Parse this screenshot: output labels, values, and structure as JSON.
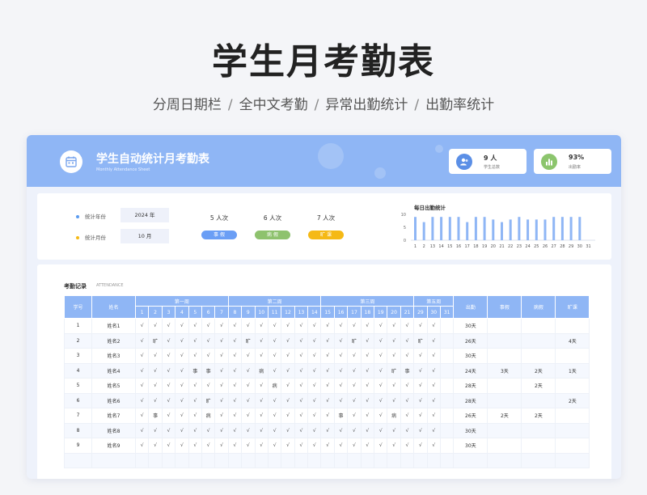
{
  "hero": {
    "title": "学生月考勤表",
    "features": [
      "分周日期栏",
      "全中文考勤",
      "异常出勤统计",
      "出勤率统计"
    ],
    "separator": "/"
  },
  "header": {
    "title": "学生自动统计月考勤表",
    "subtitle_en": "Monthly Attendance Sheet",
    "stats": [
      {
        "value": "9 人",
        "label": "学生总数",
        "icon": "users-icon",
        "color": "#5b8fe6"
      },
      {
        "value": "93%",
        "label": "出勤率",
        "icon": "bar-chart-icon",
        "color": "#8cc56d"
      }
    ]
  },
  "filters": {
    "year_label": "统计年份",
    "year_value": "2024 年",
    "month_label": "统计月份",
    "month_value": "10 月",
    "year_dot_color": "#5b9bf0",
    "month_dot_color": "#f5b915"
  },
  "summary": [
    {
      "count": "5 人次",
      "label": "事 假",
      "color": "#6a9ef5"
    },
    {
      "count": "6 人次",
      "label": "病 假",
      "color": "#8ec26e"
    },
    {
      "count": "7 人次",
      "label": "旷 课",
      "color": "#f5b915"
    }
  ],
  "chart_data": {
    "type": "bar",
    "title": "每日出勤统计",
    "categories": [
      "1",
      "2",
      "13",
      "14",
      "15",
      "16",
      "17",
      "18",
      "19",
      "20",
      "21",
      "22",
      "23",
      "24",
      "25",
      "26",
      "27",
      "28",
      "29",
      "30",
      "31"
    ],
    "values": [
      9,
      7,
      9,
      9,
      9,
      9,
      7,
      9,
      9,
      8,
      7,
      8,
      9,
      8,
      8,
      8,
      9,
      9,
      9,
      9,
      0
    ],
    "ylim": [
      0,
      10
    ],
    "yticks": [
      0,
      5,
      10
    ],
    "bar_color": "#8fb6f5"
  },
  "attendance": {
    "section_title": "考勤记录",
    "section_en": "ATTENDANCE",
    "headers": {
      "id": "学号",
      "name": "姓名",
      "weeks": [
        {
          "label": "第一周",
          "span": 7
        },
        {
          "label": "第二周",
          "span": 7
        },
        {
          "label": "第三周",
          "span": 7
        },
        {
          "label": "第五周",
          "span": 3
        }
      ],
      "days": [
        "1",
        "2",
        "3",
        "4",
        "5",
        "6",
        "7",
        "8",
        "9",
        "10",
        "11",
        "12",
        "13",
        "14",
        "15",
        "16",
        "17",
        "18",
        "19",
        "20",
        "21",
        "29",
        "30",
        "31"
      ],
      "summary": [
        "出勤",
        "事假",
        "病假",
        "旷课"
      ]
    },
    "rows": [
      {
        "id": "1",
        "name": "姓名1",
        "marks": [
          "√",
          "√",
          "√",
          "√",
          "√",
          "√",
          "√",
          "√",
          "√",
          "√",
          "√",
          "√",
          "√",
          "√",
          "√",
          "√",
          "√",
          "√",
          "√",
          "√",
          "√",
          "√",
          "√",
          ""
        ],
        "present": "30天",
        "leave": "",
        "sick": "",
        "absent": ""
      },
      {
        "id": "2",
        "name": "姓名2",
        "marks": [
          "√",
          "旷",
          "√",
          "√",
          "√",
          "√",
          "√",
          "√",
          "旷",
          "√",
          "√",
          "√",
          "√",
          "√",
          "√",
          "√",
          "旷",
          "√",
          "√",
          "√",
          "√",
          "旷",
          "√",
          ""
        ],
        "present": "26天",
        "leave": "",
        "sick": "",
        "absent": "4天"
      },
      {
        "id": "3",
        "name": "姓名3",
        "marks": [
          "√",
          "√",
          "√",
          "√",
          "√",
          "√",
          "√",
          "√",
          "√",
          "√",
          "√",
          "√",
          "√",
          "√",
          "√",
          "√",
          "√",
          "√",
          "√",
          "√",
          "√",
          "√",
          "√",
          ""
        ],
        "present": "30天",
        "leave": "",
        "sick": "",
        "absent": ""
      },
      {
        "id": "4",
        "name": "姓名4",
        "marks": [
          "√",
          "√",
          "√",
          "√",
          "事",
          "事",
          "√",
          "√",
          "√",
          "病",
          "√",
          "√",
          "√",
          "√",
          "√",
          "√",
          "√",
          "√",
          "√",
          "旷",
          "事",
          "√",
          "√",
          ""
        ],
        "present": "24天",
        "leave": "3天",
        "sick": "2天",
        "absent": "1天"
      },
      {
        "id": "5",
        "name": "姓名5",
        "marks": [
          "√",
          "√",
          "√",
          "√",
          "√",
          "√",
          "√",
          "√",
          "√",
          "√",
          "病",
          "√",
          "√",
          "√",
          "√",
          "√",
          "√",
          "√",
          "√",
          "√",
          "√",
          "√",
          "√",
          ""
        ],
        "present": "28天",
        "leave": "",
        "sick": "2天",
        "absent": ""
      },
      {
        "id": "6",
        "name": "姓名6",
        "marks": [
          "√",
          "√",
          "√",
          "√",
          "√",
          "旷",
          "√",
          "√",
          "√",
          "√",
          "√",
          "√",
          "√",
          "√",
          "√",
          "√",
          "√",
          "√",
          "√",
          "√",
          "√",
          "√",
          "√",
          ""
        ],
        "present": "28天",
        "leave": "",
        "sick": "",
        "absent": "2天"
      },
      {
        "id": "7",
        "name": "姓名7",
        "marks": [
          "√",
          "事",
          "√",
          "√",
          "√",
          "病",
          "√",
          "√",
          "√",
          "√",
          "√",
          "√",
          "√",
          "√",
          "√",
          "事",
          "√",
          "√",
          "√",
          "病",
          "√",
          "√",
          "√",
          ""
        ],
        "present": "26天",
        "leave": "2天",
        "sick": "2天",
        "absent": ""
      },
      {
        "id": "8",
        "name": "姓名8",
        "marks": [
          "√",
          "√",
          "√",
          "√",
          "√",
          "√",
          "√",
          "√",
          "√",
          "√",
          "√",
          "√",
          "√",
          "√",
          "√",
          "√",
          "√",
          "√",
          "√",
          "√",
          "√",
          "√",
          "√",
          ""
        ],
        "present": "30天",
        "leave": "",
        "sick": "",
        "absent": ""
      },
      {
        "id": "9",
        "name": "姓名9",
        "marks": [
          "√",
          "√",
          "√",
          "√",
          "√",
          "√",
          "√",
          "√",
          "√",
          "√",
          "√",
          "√",
          "√",
          "√",
          "√",
          "√",
          "√",
          "√",
          "√",
          "√",
          "√",
          "√",
          "√",
          ""
        ],
        "present": "30天",
        "leave": "",
        "sick": "",
        "absent": ""
      },
      {
        "id": "",
        "name": "",
        "marks": [
          "",
          "",
          "",
          "",
          "",
          "",
          "",
          "",
          "",
          "",
          "",
          "",
          "",
          "",
          "",
          "",
          "",
          "",
          "",
          "",
          "",
          "",
          "",
          ""
        ],
        "present": "",
        "leave": "",
        "sick": "",
        "absent": ""
      }
    ]
  }
}
